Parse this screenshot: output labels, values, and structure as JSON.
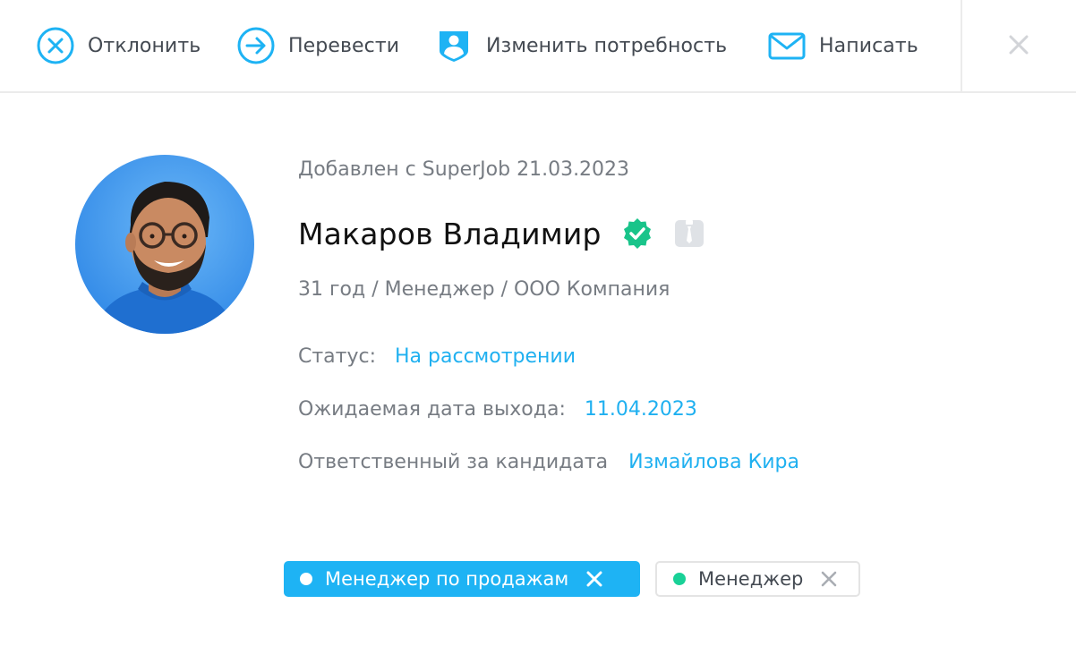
{
  "toolbar": {
    "actions": [
      {
        "id": "reject",
        "label": "Отклонить",
        "icon": "circle-x-icon"
      },
      {
        "id": "transfer",
        "label": "Перевести",
        "icon": "circle-arrow-right-icon"
      },
      {
        "id": "change_need",
        "label": "Изменить потребность",
        "icon": "shield-person-icon"
      },
      {
        "id": "write",
        "label": "Написать",
        "icon": "envelope-icon"
      }
    ],
    "close_icon": "close-icon"
  },
  "candidate": {
    "added_text": "Добавлен с SuperJob 21.03.2023",
    "name": "Макаров Владимир",
    "verified_icon": "verified-badge-icon",
    "extra_icon": "person-tie-icon",
    "subtitle": "31 год / Менеджер / ООО Компания",
    "status_label": "Статус:",
    "status_value": "На рассмотрении",
    "date_label": "Ожидаемая дата выхода:",
    "date_value": "11.04.2023",
    "owner_label": "Ответственный за кандидата",
    "owner_value": "Измайлова Кира"
  },
  "tags": [
    {
      "label": "Менеджер по продажам",
      "active": true
    },
    {
      "label": "Менеджер",
      "active": false
    }
  ],
  "colors": {
    "accent": "#1eb3f4",
    "link": "#1fb0f0",
    "verified": "#19c48a",
    "tag_dot_green": "#19d197",
    "muted_text": "#777c83"
  }
}
